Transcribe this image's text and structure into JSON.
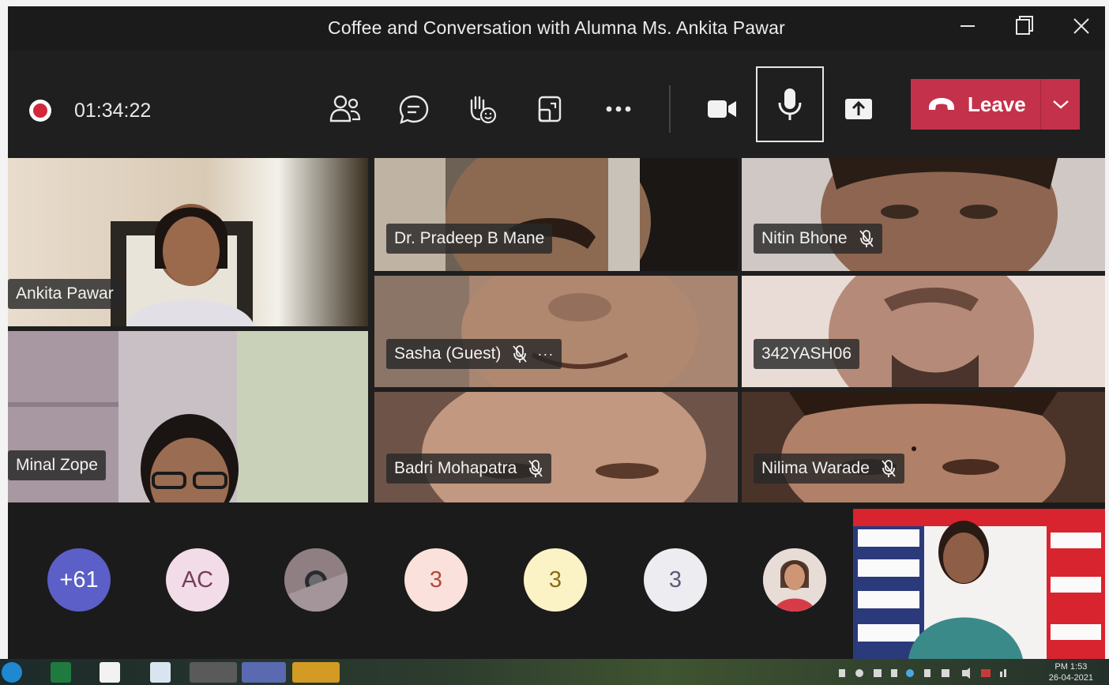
{
  "window": {
    "title": "Coffee and Conversation with Alumna Ms. Ankita Pawar",
    "minimize_icon": "minimize-icon",
    "maximize_icon": "restore-icon",
    "close_icon": "close-icon"
  },
  "toolbar": {
    "recording_time": "01:34:22",
    "buttons": [
      {
        "name": "people-button",
        "icon": "people-icon"
      },
      {
        "name": "chat-button",
        "icon": "chat-icon"
      },
      {
        "name": "raise-hand-button",
        "icon": "raise-hand-icon"
      },
      {
        "name": "rooms-button",
        "icon": "share-tray-icon"
      },
      {
        "name": "more-actions-button",
        "icon": "ellipsis-icon"
      },
      {
        "name": "camera-button",
        "icon": "video-camera-icon"
      },
      {
        "name": "mic-button",
        "icon": "microphone-icon"
      },
      {
        "name": "share-button",
        "icon": "share-upload-icon"
      }
    ],
    "leave_label": "Leave"
  },
  "participants": [
    {
      "name": "Ankita Pawar",
      "muted": false
    },
    {
      "name": "Dr. Pradeep B Mane",
      "muted": false
    },
    {
      "name": "Nitin Bhone",
      "muted": true
    },
    {
      "name": "Sasha (Guest)",
      "muted": true,
      "more": "···"
    },
    {
      "name": "342YASH06",
      "muted": false
    },
    {
      "name": "Minal Zope",
      "muted": false
    },
    {
      "name": "Badri Mohapatra",
      "muted": true
    },
    {
      "name": "Nilima Warade",
      "muted": true
    }
  ],
  "strip": {
    "overflow_count": "+61",
    "avatars": [
      {
        "initials": "AC",
        "bg": "#f1dce8",
        "fg": "#7a3b5c"
      },
      {
        "initials": "",
        "kind": "photo"
      },
      {
        "initials": "3",
        "bg": "#fbe1dc",
        "fg": "#b34a3a"
      },
      {
        "initials": "3",
        "bg": "#fbf3c6",
        "fg": "#8a6d14"
      },
      {
        "initials": "3",
        "bg": "#ececf1",
        "fg": "#5c5c73"
      },
      {
        "initials": "",
        "kind": "photo"
      }
    ]
  },
  "taskbar": {
    "time": "PM 1:53",
    "date": "26-04-2021"
  },
  "colors": {
    "leave": "#c4314b",
    "overflow": "#5b5fc7",
    "record": "#d2283a"
  }
}
